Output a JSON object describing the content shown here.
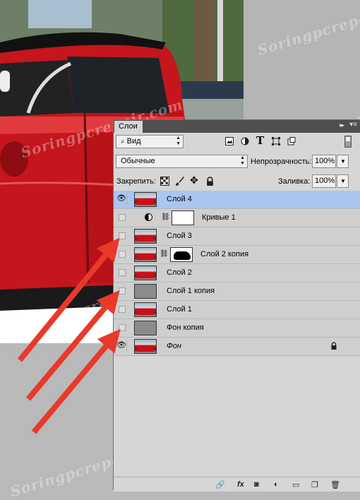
{
  "panel": {
    "tab_label": "Слои",
    "collapse_glyph": "▸▸",
    "menu_glyph": "▾≡",
    "filter_kind": "Вид",
    "blend_mode": "Обычные",
    "opacity_label": "Непрозрачность:",
    "opacity_value": "100%",
    "lock_label": "Закрепить:",
    "fill_label": "Заливка:",
    "fill_value": "100%"
  },
  "layers": [
    {
      "name": "Слой 4",
      "visible": true,
      "selected": true,
      "thumb": "car"
    },
    {
      "name": "Кривые 1",
      "visible": false,
      "selected": false,
      "thumb": "white",
      "adjustment": true
    },
    {
      "name": "Слой 3",
      "visible": false,
      "selected": false,
      "thumb": "car"
    },
    {
      "name": "Слой 2 копия",
      "visible": false,
      "selected": false,
      "thumb": "car",
      "mask": true
    },
    {
      "name": "Слой 2",
      "visible": false,
      "selected": false,
      "thumb": "car"
    },
    {
      "name": "Слой 1 копия",
      "visible": false,
      "selected": false,
      "thumb": "grey"
    },
    {
      "name": "Слой 1",
      "visible": false,
      "selected": false,
      "thumb": "car"
    },
    {
      "name": "Фон копия",
      "visible": false,
      "selected": false,
      "thumb": "grey"
    },
    {
      "name": "Фон",
      "visible": true,
      "selected": false,
      "thumb": "car",
      "italic": true,
      "locked": true
    }
  ],
  "watermark_text": "Soringpcrepair.com",
  "colors": {
    "arrow": "#e8392b",
    "selection": "#a8c6ef",
    "car_red": "#c4161c"
  }
}
